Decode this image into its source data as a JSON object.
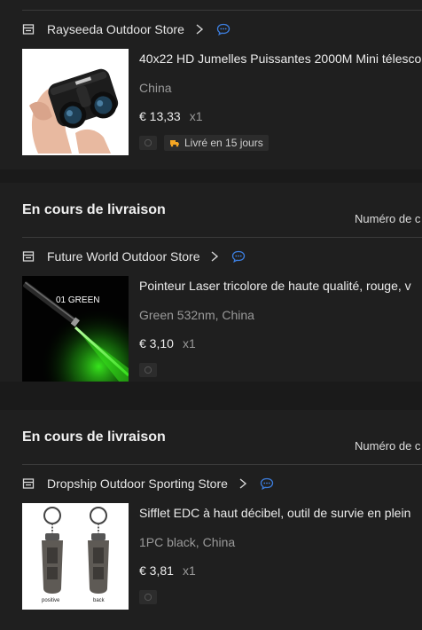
{
  "orders": [
    {
      "store": "Rayseeda Outdoor Store",
      "product_title": "40x22 HD Jumelles Puissantes 2000M Mini télesco",
      "variant": "China",
      "price": "€ 13,33",
      "qty": "x1",
      "delivery": "Livré en 15 jours"
    },
    {
      "status": "En cours de livraison",
      "order_number_label": "Numéro de c",
      "store": "Future World Outdoor Store",
      "product_title": "Pointeur Laser tricolore de haute qualité, rouge, v",
      "image_caption": "01 GREEN",
      "variant": "Green 532nm, China",
      "price": "€ 3,10",
      "qty": "x1"
    },
    {
      "status": "En cours de livraison",
      "order_number_label": "Numéro de c",
      "store": "Dropship Outdoor Sporting Store",
      "product_title": "Sifflet EDC à haut décibel, outil de survie en plein",
      "image_caption_left": "positive",
      "image_caption_right": "back",
      "variant": "1PC black, China",
      "price": "€ 3,81",
      "qty": "x1"
    }
  ],
  "colors": {
    "background": "#1a1a1a",
    "card": "#1f1f1f",
    "chat_accent": "#3d7fe0",
    "delivery_accent": "#f5a623",
    "laser_green": "#35e01a"
  }
}
